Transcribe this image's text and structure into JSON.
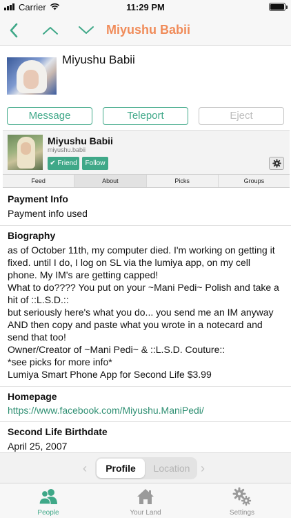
{
  "status_bar": {
    "carrier": "Carrier",
    "time": "11:29 PM"
  },
  "nav": {
    "title": "Miyushu Babii",
    "back_icon": "chevron-left-icon",
    "prev_icon": "chevron-up-icon",
    "next_icon": "chevron-down-icon"
  },
  "header": {
    "name": "Miyushu Babii"
  },
  "actions": {
    "message": "Message",
    "teleport": "Teleport",
    "eject": "Eject"
  },
  "profile": {
    "name": "Miyushu Babii",
    "username": "miyushu.babii",
    "friend_label": "✔ Friend",
    "follow_label": "Follow"
  },
  "tabs": [
    "Feed",
    "About",
    "Picks",
    "Groups"
  ],
  "about": {
    "payment_title": "Payment Info",
    "payment_value": "Payment info used",
    "bio_title": "Biography",
    "bio_lines": [
      "as of October 11th, my computer died. I'm working on getting it",
      "fixed. until I do, I log on SL via the lumiya app, on my cell",
      "phone. My IM's are getting capped!",
      "What to do???? You put on your ~Mani Pedi~ Polish and take a",
      "hit of ::L.S.D.::",
      "but seriously here's what you do... you send me an IM anyway",
      "AND then copy and paste what you wrote in a notecard and",
      "send that too!",
      "Owner/Creator of ~Mani Pedi~ & ::L.S.D. Couture::",
      "*see picks for more info*",
      "Lumiya Smart Phone App for Second Life $3.99"
    ],
    "homepage_title": "Homepage",
    "homepage_value": "https://www.facebook.com/Miyushu.ManiPedi/",
    "birthdate_title": "Second Life Birthdate",
    "birthdate_value": "April 25, 2007"
  },
  "segment": {
    "profile": "Profile",
    "location": "Location"
  },
  "tabbar": {
    "people": "People",
    "your_land": "Your Land",
    "settings": "Settings"
  },
  "colors": {
    "accent": "#3fa888",
    "title": "#f08c5a"
  }
}
